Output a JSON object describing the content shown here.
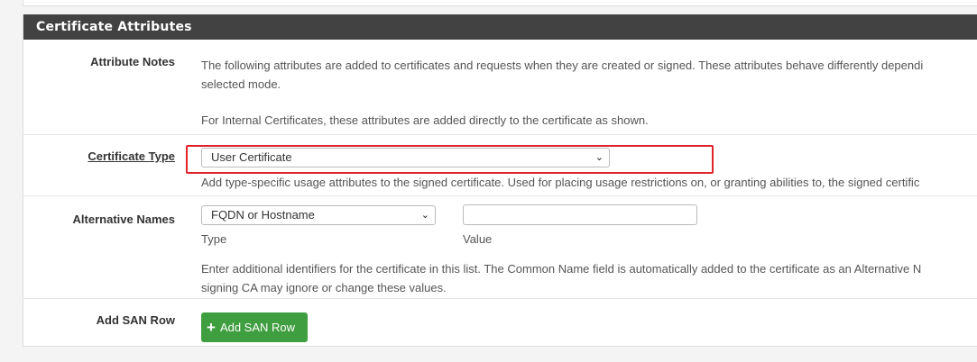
{
  "panel": {
    "title": "Certificate Attributes"
  },
  "attribute_notes": {
    "label": "Attribute Notes",
    "line1": "The following attributes are added to certificates and requests when they are created or signed. These attributes behave differently dependi",
    "line2": "selected mode.",
    "line3": "For Internal Certificates, these attributes are added directly to the certificate as shown."
  },
  "certificate_type": {
    "label": "Certificate Type",
    "selected": "User Certificate",
    "help": "Add type-specific usage attributes to the signed certificate. Used for placing usage restrictions on, or granting abilities to, the signed certific"
  },
  "alternative_names": {
    "label": "Alternative Names",
    "type_selected": "FQDN or Hostname",
    "value": "",
    "type_label": "Type",
    "value_label": "Value",
    "help_line1": "Enter additional identifiers for the certificate in this list. The Common Name field is automatically added to the certificate as an Alternative N",
    "help_line2": "signing CA may ignore or change these values."
  },
  "add_san": {
    "label": "Add SAN Row",
    "button": "Add SAN Row"
  }
}
